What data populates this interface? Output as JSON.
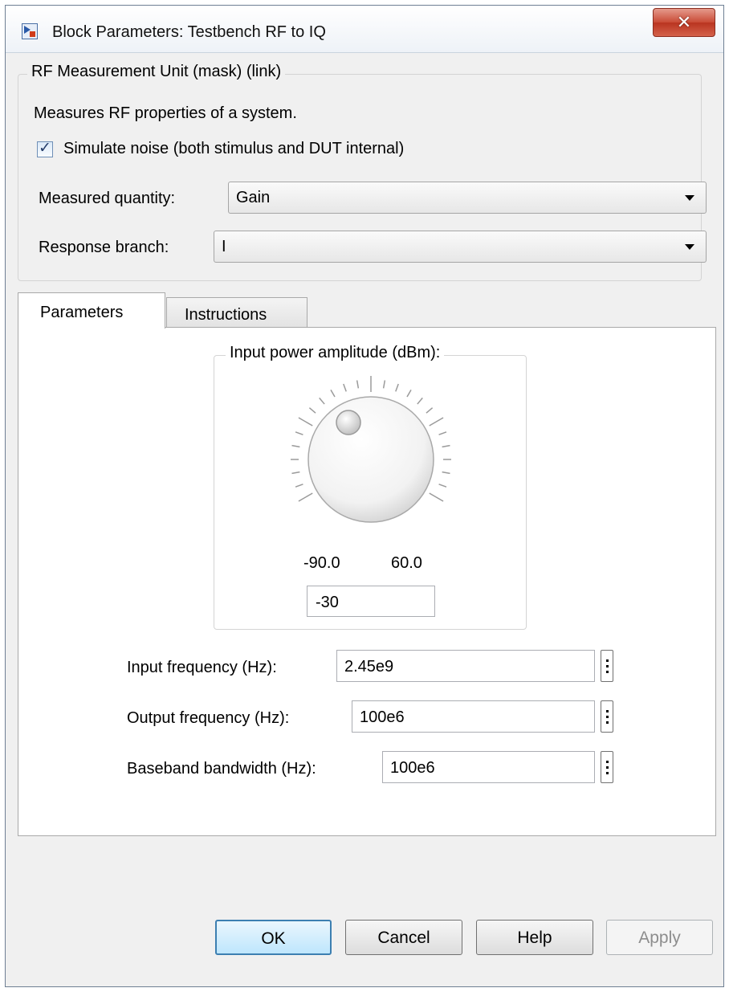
{
  "window": {
    "title": "Block Parameters: Testbench RF to IQ"
  },
  "mask": {
    "group_title": "RF Measurement Unit (mask) (link)",
    "description": "Measures RF properties of a system.",
    "simulate_noise_label": "Simulate noise (both stimulus and DUT internal)",
    "simulate_noise_checked": true,
    "measured_quantity_label": "Measured quantity:",
    "measured_quantity_value": "Gain",
    "response_branch_label": "Response branch:",
    "response_branch_value": "I"
  },
  "tabs": [
    {
      "label": "Parameters",
      "active": true
    },
    {
      "label": "Instructions",
      "active": false
    }
  ],
  "parameters": {
    "knob_title": "Input power amplitude (dBm):",
    "knob_min": "-90.0",
    "knob_max": "60.0",
    "knob_value": "-30",
    "input_frequency_label": "Input frequency (Hz):",
    "input_frequency_value": "2.45e9",
    "output_frequency_label": "Output frequency (Hz):",
    "output_frequency_value": "100e6",
    "baseband_bandwidth_label": "Baseband bandwidth (Hz):",
    "baseband_bandwidth_value": "100e6"
  },
  "buttons": {
    "ok": "OK",
    "cancel": "Cancel",
    "help": "Help",
    "apply": "Apply"
  },
  "icons": {
    "app": "simulink-block-icon",
    "close": "close-icon",
    "knob": "rotary-knob",
    "more": "vertical-ellipsis-icon"
  },
  "colors": {
    "close_button": "#c94a35",
    "default_button_border": "#3c7fb1",
    "window_bg": "#f0f0f0"
  }
}
